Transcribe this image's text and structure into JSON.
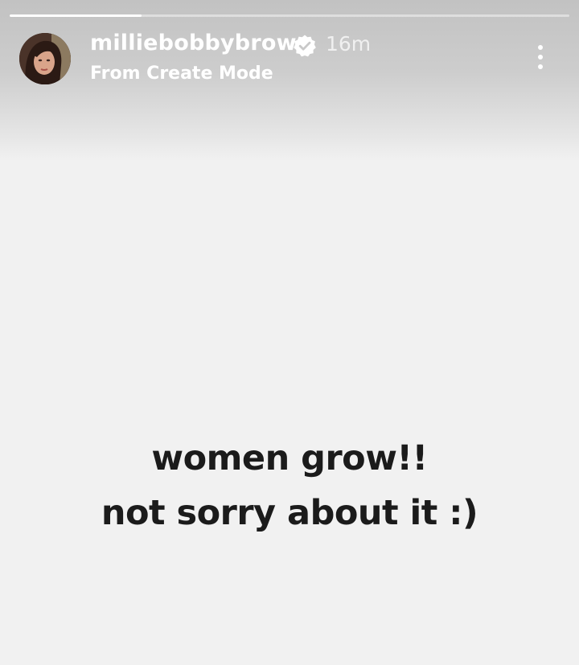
{
  "story": {
    "progress_fraction": 0.235,
    "author": {
      "username": "milliebobbybrown",
      "verified": true,
      "time_ago": "16m",
      "subtitle": "From Create Mode",
      "avatar_icon": "profile-photo"
    },
    "menu_icon": "more-vertical-icon",
    "caption": {
      "line1": "women grow!!",
      "line2": "not sorry about it :)"
    },
    "colors": {
      "background": "#f1f1f1",
      "caption_text": "#1b1b1b",
      "verified_badge": "#ffffff"
    }
  }
}
